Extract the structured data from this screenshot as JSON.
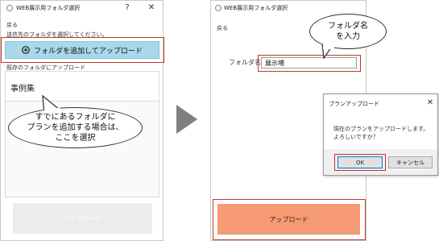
{
  "left": {
    "title": "WEB展示用フォルダ選択",
    "help": "?",
    "close": "✕",
    "back": "戻る",
    "instruction": "送信先のフォルダを選択してください。",
    "add_folder_button": "フォルダを追加してアップロード",
    "existing_label": "既存のフォルダにアップロード",
    "folder_item": "事例集",
    "callout": [
      "すでにあるフォルダに",
      "プランを追加する場合は、",
      "ここを選択"
    ],
    "upload_button": "アップロード"
  },
  "right": {
    "title": "WEB展示用フォルダ選択",
    "help": "?",
    "close": "✕",
    "back": "戻る",
    "folder_name_label": "フォルダ名：",
    "folder_name_value": "展示場",
    "callout": [
      "フォルダ名",
      "を入力"
    ],
    "upload_button": "アップロード"
  },
  "dialog": {
    "title": "プランアップロード",
    "close": "✕",
    "message_line1": "現在のプランをアップロードします。",
    "message_line2": "よろしいですか？",
    "ok": "OK",
    "cancel": "キャンセル"
  },
  "colors": {
    "add_button": "#a8d8ea",
    "upload_disabled": "#ececec",
    "upload_active": "#f59a72",
    "highlight": "#c0392b",
    "arrow": "#7f7f7f"
  },
  "icons": [
    "app-icon",
    "plus-circle-icon",
    "next-arrow-icon"
  ]
}
